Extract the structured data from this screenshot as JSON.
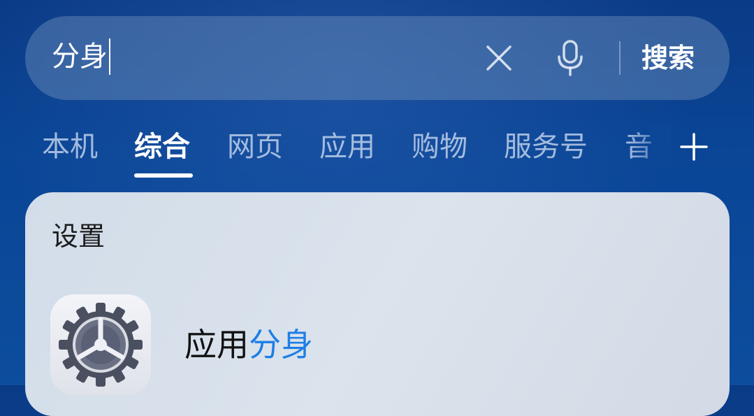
{
  "search": {
    "query": "分身",
    "search_button_label": "搜索",
    "clear_icon": "close-icon",
    "mic_icon": "microphone-icon"
  },
  "tabs": [
    {
      "label": "本机",
      "active": false
    },
    {
      "label": "综合",
      "active": true
    },
    {
      "label": "网页",
      "active": false
    },
    {
      "label": "应用",
      "active": false
    },
    {
      "label": "购物",
      "active": false
    },
    {
      "label": "服务号",
      "active": false
    },
    {
      "label": "音",
      "active": false
    }
  ],
  "add_tab_icon": "plus-icon",
  "results_card": {
    "title": "设置",
    "items": [
      {
        "icon": "settings-gear-icon",
        "label_prefix": "应用",
        "label_highlight": "分身"
      }
    ]
  },
  "colors": {
    "background": "#0a4596",
    "highlight": "#1e7fe6",
    "card": "#d8e1eb"
  }
}
